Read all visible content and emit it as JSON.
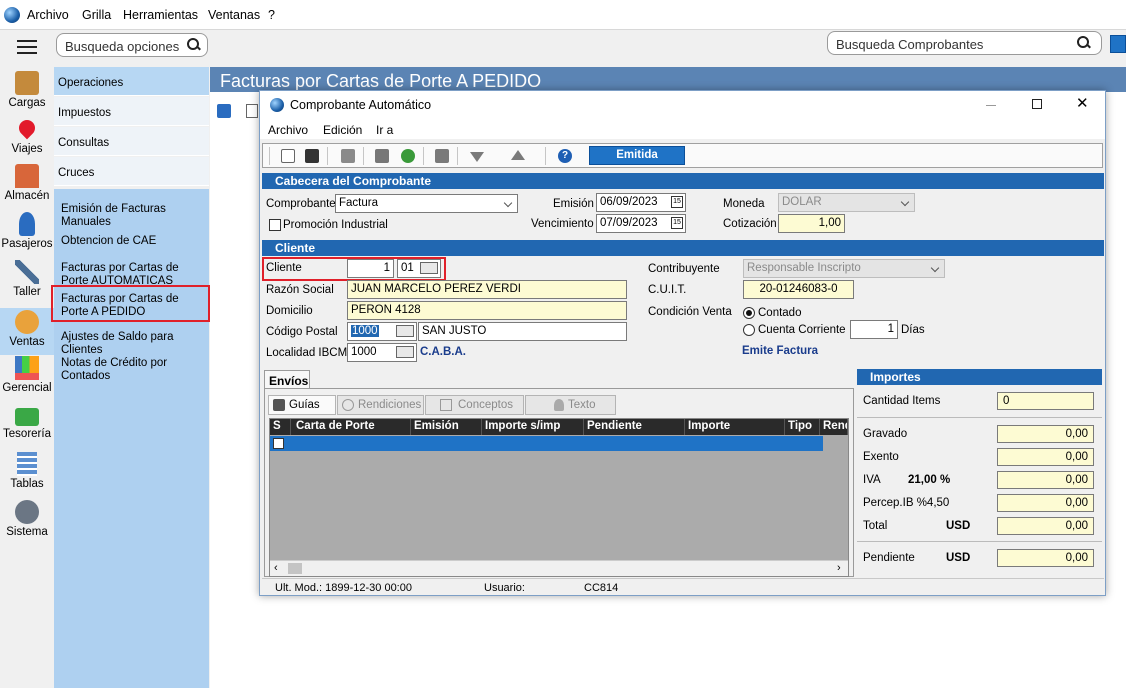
{
  "app": {
    "menu": [
      "Archivo",
      "Grilla",
      "Herramientas",
      "Ventanas",
      "?"
    ],
    "search_options_placeholder": "Busqueda opciones",
    "search_comprobantes_placeholder": "Busqueda Comprobantes"
  },
  "sidebar": {
    "items": [
      {
        "label": "Cargas",
        "icon": "box-icon"
      },
      {
        "label": "Viajes",
        "icon": "location-pin-icon"
      },
      {
        "label": "Almacén",
        "icon": "warehouse-icon"
      },
      {
        "label": "Pasajeros",
        "icon": "passenger-icon"
      },
      {
        "label": "Taller",
        "icon": "tools-icon"
      },
      {
        "label": "Ventas",
        "icon": "sales-icon"
      },
      {
        "label": "Gerencial",
        "icon": "chart-icon"
      },
      {
        "label": "Tesorería",
        "icon": "money-icon"
      },
      {
        "label": "Tablas",
        "icon": "table-icon"
      },
      {
        "label": "Sistema",
        "icon": "gear-icon"
      }
    ],
    "active": "Ventas"
  },
  "submenu": {
    "categories": [
      "Operaciones",
      "Impuestos",
      "Consultas",
      "Cruces"
    ],
    "options": [
      "Emisión de Facturas Manuales",
      "Obtencion de CAE",
      "Facturas por Cartas de Porte AUTOMATICAS",
      "Facturas por Cartas de Porte A PEDIDO",
      "Ajustes de Saldo para Clientes",
      "Notas de Crédito por Contados"
    ]
  },
  "page": {
    "title": "Facturas por Cartas de Porte A PEDIDO"
  },
  "dialog": {
    "title": "Comprobante Automático",
    "menu": [
      "Archivo",
      "Edición",
      "Ir a"
    ],
    "status": "Emitida",
    "header_section": "Cabecera del Comprobante",
    "comprobante_label": "Comprobante",
    "comprobante_value": "Factura",
    "promocion_label": "Promoción Industrial",
    "emision_label": "Emisión",
    "emision_value": "06/09/2023",
    "vencimiento_label": "Vencimiento",
    "vencimiento_value": "07/09/2023",
    "moneda_label": "Moneda",
    "moneda_value": "DOLAR",
    "cotizacion_label": "Cotización",
    "cotizacion_value": "1,00",
    "client_section": "Cliente",
    "cliente_label": "Cliente",
    "cliente_num": "1",
    "cliente_suc": "01",
    "razon_label": "Razón Social",
    "razon_value": "JUAN MARCELO PEREZ VERDI",
    "domicilio_label": "Domicilio",
    "domicilio_value": "PERON 4128",
    "cp_label": "Código Postal",
    "cp_value": "1000",
    "cp_city": "SAN JUSTO",
    "localidad_label": "Localidad IBCM",
    "localidad_value": "1000",
    "localidad_city": "C.A.B.A.",
    "contribuyente_label": "Contribuyente",
    "contribuyente_value": "Responsable Inscripto",
    "cuit_label": "C.U.I.T.",
    "cuit_value": "20-01246083-0",
    "condicion_label": "Condición Venta",
    "contado_label": "Contado",
    "cuenta_label": "Cuenta Corriente",
    "dias_value": "1",
    "dias_label": "Días",
    "emite_factura": "Emite Factura",
    "envios_tab": "Envíos",
    "subtabs": [
      "Guías",
      "Rendiciones",
      "Conceptos",
      "Texto"
    ],
    "grid_headers": [
      "S",
      "Carta de Porte",
      "Emisión",
      "Importe s/imp",
      "Pendiente",
      "Importe",
      "Tipo",
      "Rend"
    ],
    "importes": {
      "title": "Importes",
      "cantidad_label": "Cantidad Items",
      "cantidad_value": "0",
      "gravado_label": "Gravado",
      "gravado_value": "0,00",
      "exento_label": "Exento",
      "exento_value": "0,00",
      "iva_label": "IVA",
      "iva_rate": "21,00 %",
      "iva_value": "0,00",
      "percep_label": "Percep.IB %4,50",
      "percep_value": "0,00",
      "total_label": "Total",
      "total_currency": "USD",
      "total_value": "0,00",
      "pendiente_label": "Pendiente",
      "pendiente_currency": "USD",
      "pendiente_value": "0,00"
    },
    "statusbar": {
      "ult_mod": "Ult. Mod.: 1899-12-30 00:00",
      "usuario_label": "Usuario:",
      "usuario_value": "CC814"
    }
  },
  "colors": {
    "accent": "#2167b1",
    "highlight": "#e0202a",
    "field_yellow": "#fdfbd3",
    "menu_blue": "#aed0f0"
  }
}
